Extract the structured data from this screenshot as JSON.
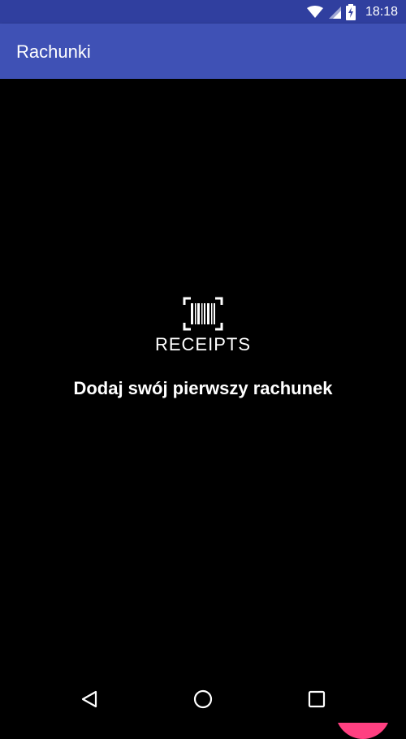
{
  "status_bar": {
    "time": "18:18",
    "icons": [
      "wifi-icon",
      "signal-icon",
      "battery-charging-icon"
    ]
  },
  "app_bar": {
    "title": "Rachunki"
  },
  "logo": {
    "text": "RECEIPTS"
  },
  "empty_state": {
    "message": "Dodaj swój pierwszy rachunek"
  },
  "fab": {
    "icon": "plus-icon",
    "color": "#ff4081",
    "icon_color": "#8bc34a"
  },
  "nav": {
    "items": [
      "back-icon",
      "home-icon",
      "recents-icon"
    ]
  },
  "colors": {
    "primary": "#3f51b5",
    "primary_dark": "#303f9f",
    "background": "#000000"
  }
}
